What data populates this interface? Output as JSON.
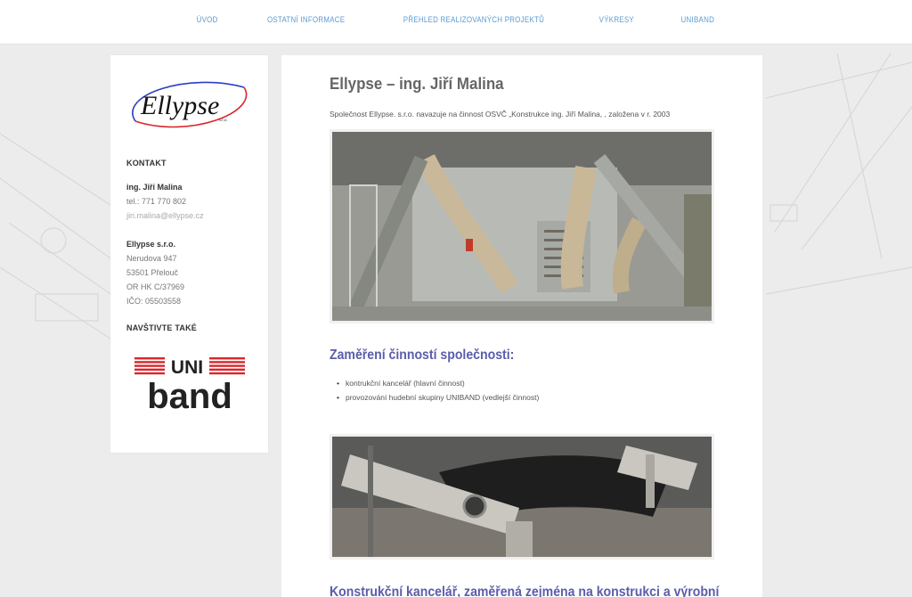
{
  "nav": {
    "items": [
      {
        "label": "ÚVOD"
      },
      {
        "label": "OSTATNÍ INFORMACE"
      },
      {
        "label": "PŘEHLED REALIZOVANÝCH PROJEKTŮ"
      },
      {
        "label": "VÝKRESY"
      },
      {
        "label": "UNIBAND"
      }
    ]
  },
  "sidebar": {
    "logo_text": "Ellypse",
    "logo_sub": "s.r.o.",
    "contact_heading": "KONTAKT",
    "contact_name": "ing. Jiří Malina",
    "contact_phone": "tel.: 771 770 802",
    "contact_email": "jiri.malina@ellypse.cz",
    "company_name": "Ellypse s.r.o.",
    "company_street": "Nerudova 947",
    "company_city": "53501 Přelouč",
    "company_register": "OR HK C/37969",
    "company_ico": "IČO: 05503558",
    "visit_heading": "NAVŠTIVTE TAKÉ",
    "uniband_top": "UNI",
    "uniband_bottom": "band"
  },
  "main": {
    "title": "Ellypse – ing. Jiří Malina",
    "intro": "Společnost Ellypse. s.r.o. navazuje na činnost OSVČ „Konstrukce ing. Jiří Malina, , založena v r. 2003",
    "section1_title": "Zaměření činností společnosti:",
    "section1_items": [
      "kontrukční kancelář (hlavní činnost)",
      "provozování hudební skupiny UNIBAND (vedlejší činnost)"
    ],
    "section2_title": "Konstrukční kancelář, zaměřená zejména na konstrukci a výrobní"
  },
  "colors": {
    "nav_link": "#5a9bd4",
    "section_title": "#5b5dab",
    "logo_blue": "#2a3fc2",
    "logo_red": "#d8262b",
    "uniband_red": "#d8262b"
  }
}
